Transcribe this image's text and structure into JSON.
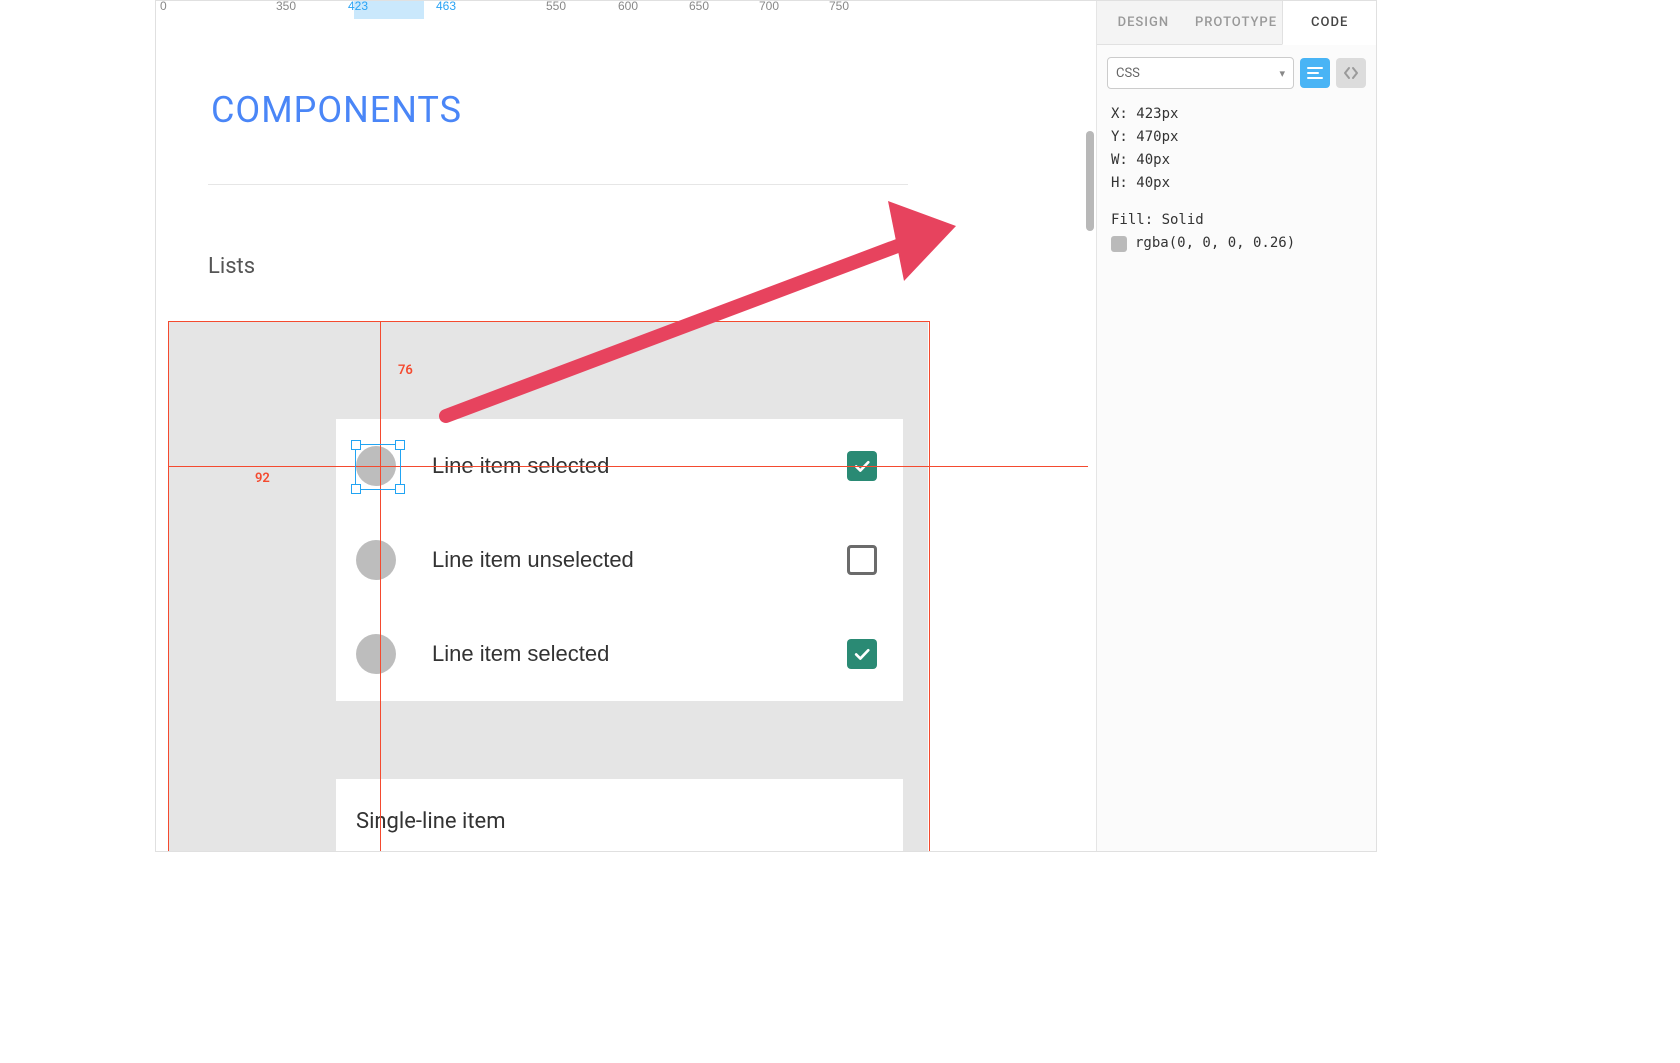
{
  "ruler": {
    "ticks": [
      "0",
      "350",
      "423",
      "463",
      "550",
      "600",
      "650",
      "700",
      "750"
    ],
    "sel_from": "423",
    "sel_to": "463"
  },
  "page": {
    "title": "COMPONENTS",
    "section": "Lists"
  },
  "list": {
    "items": [
      {
        "label": "Line item selected",
        "checked": true
      },
      {
        "label": "Line item unselected",
        "checked": false
      },
      {
        "label": "Line item selected",
        "checked": true
      }
    ],
    "single_line": "Single-line item"
  },
  "guides": {
    "top_gap": "76",
    "left_gap": "92"
  },
  "selection": {
    "dim": "40 x 40"
  },
  "inspector": {
    "tabs": {
      "design": "DESIGN",
      "prototype": "PROTOTYPE",
      "code": "CODE"
    },
    "format": "CSS",
    "props": {
      "x": "X: 423px",
      "y": "Y: 470px",
      "w": "W: 40px",
      "h": "H: 40px",
      "fill_label": "Fill: Solid",
      "fill_value": "rgba(0, 0, 0, 0.26)"
    }
  }
}
